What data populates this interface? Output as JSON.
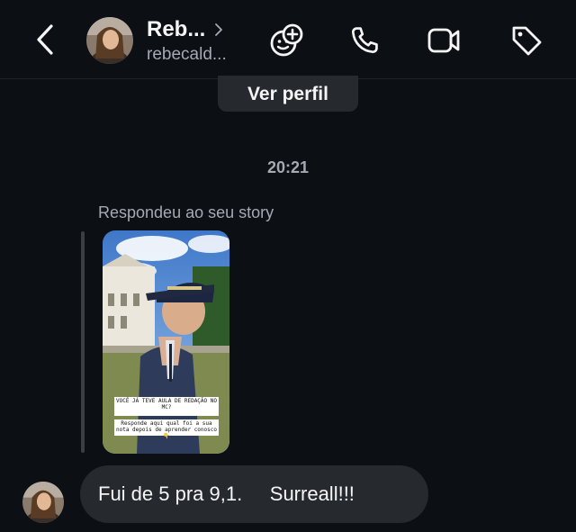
{
  "header": {
    "contact_name": "Reb...",
    "username": "rebecald...",
    "icons": [
      "back-chevron-icon",
      "chevron-right-icon",
      "sticker-add-icon",
      "phone-icon",
      "video-camera-icon",
      "tag-icon"
    ]
  },
  "profile_button_label": "Ver perfil",
  "timestamp": "20:21",
  "reply_label": "Respondeu ao seu story",
  "story": {
    "question_text": "VOCÊ JÁ TEVE AULA DE REDAÇÃO NO MC?",
    "answer_text": "Responde aqui qual foi a sua nota depois de aprender conosco👇"
  },
  "message": {
    "text": "Fui de 5 pra 9,1.     Surreall!!!"
  },
  "colors": {
    "background": "#0c1014",
    "bubble": "#262a2f",
    "secondary_text": "#a8a8b3",
    "primary_text": "#f5f5f5"
  }
}
